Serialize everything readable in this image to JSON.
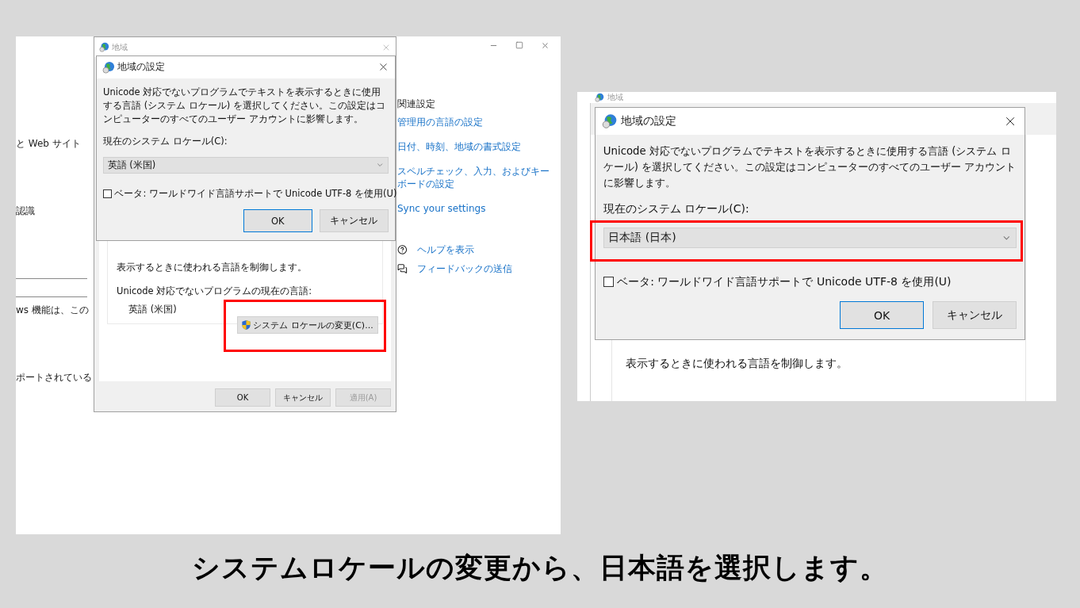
{
  "slide": {
    "caption": "システムロケールの変更から、日本語を選択します。"
  },
  "left_screenshot": {
    "settings": {
      "fragments": [
        "と Web サイト",
        "認識",
        "ws 機能は、この",
        "ポートされている"
      ],
      "related_heading": "関連設定",
      "related_links": [
        "管理用の言語の設定",
        "日付、時刻、地域の書式設定",
        "スペルチェック、入力、およびキーボードの設定",
        "Sync your settings"
      ],
      "help_links": [
        {
          "kind": "help",
          "label": "ヘルプを表示"
        },
        {
          "kind": "feedback",
          "label": "フィードバックの送信"
        }
      ]
    },
    "region_window": {
      "title": "地域",
      "description": "表示するときに使われる言語を制御します。",
      "current_language_label": "Unicode 対応でないプログラムの現在の言語:",
      "current_language": "英語 (米国)",
      "change_button": {
        "label": "システム ロケールの変更(C)...",
        "highlighted": true
      },
      "buttons": [
        {
          "label": "OK",
          "disabled": false
        },
        {
          "label": "キャンセル",
          "disabled": false
        },
        {
          "label": "適用(A)",
          "disabled": true
        }
      ]
    },
    "locale_dialog": {
      "title": "地域の設定",
      "description": "Unicode 対応でないプログラムでテキストを表示するときに使用する言語 (システム ロケール) を選択してください。この設定はコンピューターのすべてのユーザー アカウントに影響します。",
      "locale_label": "現在のシステム ロケール(C):",
      "locale_value": "英語 (米国)",
      "utf8_beta": {
        "label": "ベータ: ワールドワイド言語サポートで Unicode UTF-8 を使用(U)",
        "checked": false
      },
      "buttons": [
        {
          "label": "OK",
          "default": true
        },
        {
          "label": "キャンセル",
          "default": false
        }
      ]
    }
  },
  "right_screenshot": {
    "background_title": "地域",
    "background_text": "表示するときに使われる言語を制御します。",
    "locale_dialog": {
      "title": "地域の設定",
      "description": "Unicode 対応でないプログラムでテキストを表示するときに使用する言語 (システム ロケール) を選択してください。この設定はコンピューターのすべてのユーザー アカウントに影響します。",
      "locale_label": "現在のシステム ロケール(C):",
      "locale_value": "日本語 (日本)",
      "highlighted": true,
      "utf8_beta": {
        "label": "ベータ: ワールドワイド言語サポートで Unicode UTF-8 を使用(U)",
        "checked": false
      },
      "buttons": [
        {
          "label": "OK",
          "default": true
        },
        {
          "label": "キャンセル",
          "default": false
        }
      ]
    }
  }
}
